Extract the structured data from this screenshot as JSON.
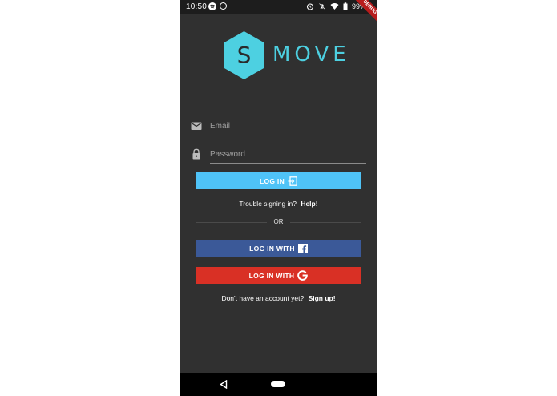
{
  "status": {
    "time": "10:50",
    "battery": "99%",
    "left_icons": [
      "spotify-icon",
      "whatsapp-icon"
    ],
    "right_icons": [
      "alarm-icon",
      "notifications-off-icon",
      "wifi-icon",
      "battery-icon"
    ]
  },
  "debug_banner": "DEBUG",
  "logo": {
    "letter": "S",
    "word": "MOVE",
    "color": "#4dd0e1"
  },
  "form": {
    "email_placeholder": "Email",
    "password_placeholder": "Password",
    "login_label": "LOG IN",
    "trouble_text": "Trouble signing in?",
    "help_link": "Help!",
    "or_text": "OR",
    "facebook_label": "LOG IN WITH",
    "google_label": "LOG IN WITH",
    "no_account_text": "Don't have an account yet?",
    "signup_link": "Sign up!"
  },
  "colors": {
    "background": "#303030",
    "login_button": "#4fc3f7",
    "facebook_button": "#3b5998",
    "google_button": "#d93025"
  }
}
